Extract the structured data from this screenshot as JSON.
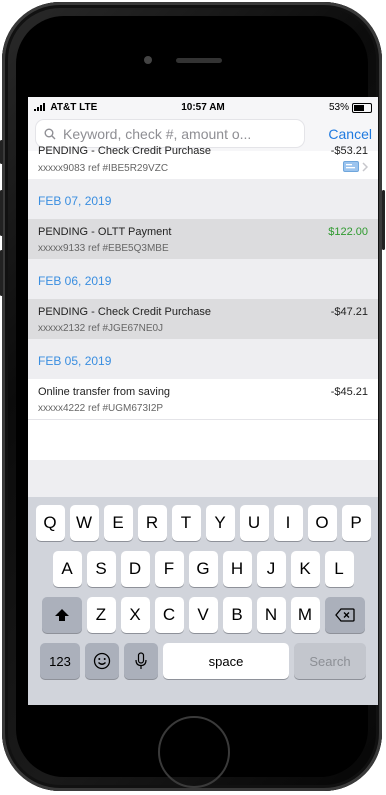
{
  "status_bar": {
    "carrier": "AT&T  LTE",
    "time": "10:57 AM",
    "battery": "53%"
  },
  "search": {
    "placeholder": "Keyword, check #, amount o...",
    "cancel_label": "Cancel"
  },
  "transactions_first": {
    "desc": "PENDING - Check Credit Purchase",
    "ref": "xxxxx9083 ref #IBE5R29VZC",
    "amount": "-$53.21"
  },
  "groups": [
    {
      "date": "FEB 07, 2019",
      "items": [
        {
          "desc": "PENDING - OLTT Payment",
          "ref": "xxxxx9133 ref #EBE5Q3MBE",
          "amount": "$122.00"
        }
      ]
    },
    {
      "date": "FEB 06, 2019",
      "items": [
        {
          "desc": "PENDING - Check Credit Purchase",
          "ref": "xxxxx2132 ref #JGE67NE0J",
          "amount": "-$47.21"
        }
      ]
    },
    {
      "date": "FEB 05, 2019",
      "items": [
        {
          "desc": "Online transfer from saving",
          "ref": "xxxxx4222 ref #UGM673I2P",
          "amount": "-$45.21"
        }
      ]
    }
  ],
  "keyboard": {
    "row1": [
      "Q",
      "W",
      "E",
      "R",
      "T",
      "Y",
      "U",
      "I",
      "O",
      "P"
    ],
    "row2": [
      "A",
      "S",
      "D",
      "F",
      "G",
      "H",
      "J",
      "K",
      "L"
    ],
    "row3": [
      "Z",
      "X",
      "C",
      "V",
      "B",
      "N",
      "M"
    ],
    "numbers_label": "123",
    "space_label": "space",
    "search_label": "Search"
  },
  "colors": {
    "accent": "#1f7ae0",
    "date_header": "#3a8ee0",
    "positive": "#2f9a2f"
  }
}
